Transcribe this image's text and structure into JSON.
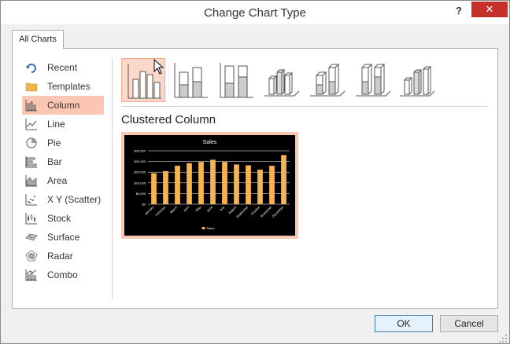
{
  "dialog": {
    "title": "Change Chart Type",
    "help_label": "?",
    "close_label": "✕"
  },
  "tabs": [
    {
      "label": "All Charts",
      "selected": true
    }
  ],
  "sidebar": {
    "items": [
      {
        "label": "Recent",
        "icon": "recent-icon"
      },
      {
        "label": "Templates",
        "icon": "folder-icon"
      },
      {
        "label": "Column",
        "icon": "column-chart-icon",
        "selected": true
      },
      {
        "label": "Line",
        "icon": "line-chart-icon"
      },
      {
        "label": "Pie",
        "icon": "pie-chart-icon"
      },
      {
        "label": "Bar",
        "icon": "bar-chart-icon"
      },
      {
        "label": "Area",
        "icon": "area-chart-icon"
      },
      {
        "label": "X Y (Scatter)",
        "icon": "scatter-chart-icon"
      },
      {
        "label": "Stock",
        "icon": "stock-chart-icon"
      },
      {
        "label": "Surface",
        "icon": "surface-chart-icon"
      },
      {
        "label": "Radar",
        "icon": "radar-chart-icon"
      },
      {
        "label": "Combo",
        "icon": "combo-chart-icon"
      }
    ]
  },
  "subtypes": [
    {
      "icon": "clustered-column-icon",
      "selected": true
    },
    {
      "icon": "stacked-column-icon"
    },
    {
      "icon": "100-stacked-column-icon"
    },
    {
      "icon": "3d-clustered-column-icon"
    },
    {
      "icon": "3d-stacked-column-icon"
    },
    {
      "icon": "3d-100-stacked-column-icon"
    },
    {
      "icon": "3d-column-icon"
    }
  ],
  "selected_chart_name": "Clustered Column",
  "chart_data": {
    "type": "bar",
    "title": "Sales",
    "categories": [
      "January",
      "February",
      "March",
      "April",
      "May",
      "June",
      "July",
      "August",
      "September",
      "October",
      "November",
      "December"
    ],
    "series": [
      {
        "name": "Sales",
        "values": [
          14500,
          15500,
          18000,
          19200,
          19800,
          20800,
          19800,
          18600,
          18200,
          16200,
          18000,
          23000
        ]
      }
    ],
    "ylim": [
      0,
      25000
    ],
    "yticks": [
      "$0",
      "$5,000",
      "$10,000",
      "$15,000",
      "$20,000",
      "$25,000"
    ],
    "grid": true,
    "legend": "bottom",
    "colors": {
      "bar": "#f6b34f",
      "background": "#000000",
      "grid": "#ffffff",
      "text": "#ffffff"
    }
  },
  "buttons": {
    "ok_label": "OK",
    "cancel_label": "Cancel"
  },
  "colors": {
    "selection": "#fbc7b3",
    "close_button": "#c7302b"
  }
}
